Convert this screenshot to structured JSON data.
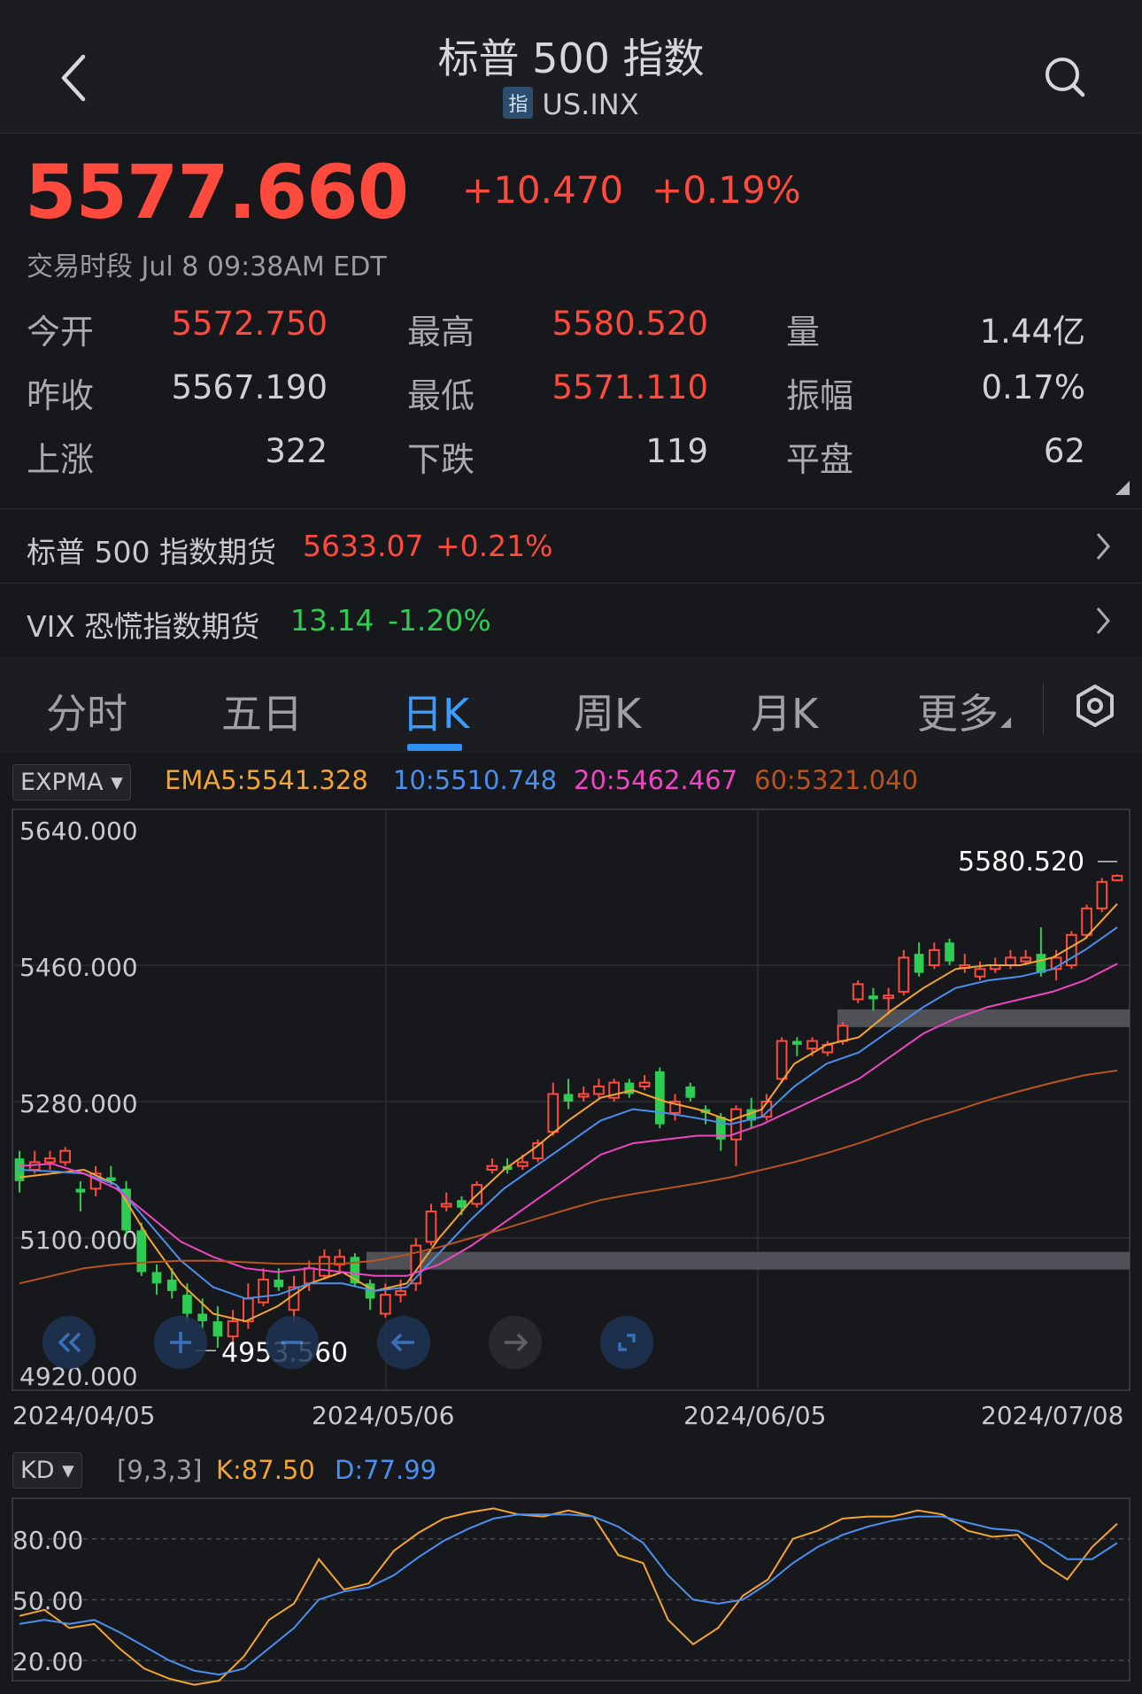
{
  "header": {
    "title": "标普 500 指数",
    "badge": "指",
    "code": "US.INX",
    "back_icon": "chevron-left-icon",
    "search_icon": "search-icon"
  },
  "quote": {
    "price": "5577.660",
    "change": "+10.470",
    "change_pct": "+0.19%",
    "session": "交易时段 Jul 8 09:38AM EDT"
  },
  "stats": [
    [
      {
        "label": "今开",
        "value": "5572.750",
        "color": "red"
      },
      {
        "label": "最高",
        "value": "5580.520",
        "color": "red"
      },
      {
        "label": "量",
        "value": "1.44亿",
        "color": "gray"
      }
    ],
    [
      {
        "label": "昨收",
        "value": "5567.190",
        "color": "gray"
      },
      {
        "label": "最低",
        "value": "5571.110",
        "color": "red"
      },
      {
        "label": "振幅",
        "value": "0.17%",
        "color": "gray"
      }
    ],
    [
      {
        "label": "上涨",
        "value": "322",
        "color": "gray"
      },
      {
        "label": "下跌",
        "value": "119",
        "color": "gray"
      },
      {
        "label": "平盘",
        "value": "62",
        "color": "gray"
      }
    ]
  ],
  "futures": [
    {
      "label": "标普 500 指数期货",
      "value": "5633.07",
      "pct": "+0.21%",
      "color": "red"
    },
    {
      "label": "VIX 恐慌指数期货",
      "value": "13.14",
      "pct": "-1.20%",
      "color": "green"
    }
  ],
  "tabs": [
    "分时",
    "五日",
    "日K",
    "周K",
    "月K",
    "更多"
  ],
  "active_tab": "日K",
  "indicator": {
    "name": "EXPMA",
    "ema5": "EMA5:5541.328",
    "ema10": "10:5510.748",
    "ema20": "20:5462.467",
    "ema60": "60:5321.040"
  },
  "kd": {
    "name": "KD",
    "params": "[9,3,3]",
    "k": "K:87.50",
    "d": "D:77.99"
  },
  "colors": {
    "up": "#ff4a3d",
    "down": "#2ecc52",
    "ema5": "#f4a531",
    "ema10": "#4b8ff0",
    "ema20": "#ee46c4",
    "ema60": "#b9541f",
    "accent": "#3a9dff"
  },
  "chart_data": [
    {
      "type": "candlestick",
      "y_ticks": [
        "5640.000",
        "5460.000",
        "5280.000",
        "5100.000",
        "4920.000"
      ],
      "ylim": [
        4920,
        5640
      ],
      "x_ticks": [
        "2024/04/05",
        "2024/05/06",
        "2024/06/05",
        "2024/07/08"
      ],
      "high_label": "5580.520",
      "low_label": "4953.560",
      "candles": [
        [
          5205,
          5175,
          5215,
          5160
        ],
        [
          5190,
          5200,
          5215,
          5185
        ],
        [
          5200,
          5205,
          5215,
          5190
        ],
        [
          5200,
          5215,
          5220,
          5195
        ],
        [
          5165,
          5160,
          5175,
          5135
        ],
        [
          5165,
          5185,
          5195,
          5155
        ],
        [
          5180,
          5175,
          5195,
          5170
        ],
        [
          5165,
          5110,
          5175,
          5105
        ],
        [
          5110,
          5055,
          5120,
          5050
        ],
        [
          5055,
          5040,
          5065,
          5025
        ],
        [
          5045,
          5030,
          5060,
          5020
        ],
        [
          5025,
          5000,
          5040,
          4990
        ],
        [
          5000,
          4990,
          5020,
          4980
        ],
        [
          4990,
          4970,
          5010,
          4955
        ],
        [
          4970,
          4990,
          5005,
          4960
        ],
        [
          4990,
          5020,
          5040,
          4980
        ],
        [
          5015,
          5045,
          5060,
          5010
        ],
        [
          5045,
          5035,
          5060,
          5030
        ],
        [
          5005,
          5035,
          5050,
          4990
        ],
        [
          5040,
          5060,
          5070,
          5030
        ],
        [
          5050,
          5075,
          5085,
          5045
        ],
        [
          5065,
          5075,
          5085,
          5055
        ],
        [
          5075,
          5040,
          5080,
          5035
        ],
        [
          5040,
          5020,
          5045,
          5005
        ],
        [
          5000,
          5025,
          5040,
          4995
        ],
        [
          5025,
          5030,
          5045,
          5015
        ],
        [
          5040,
          5090,
          5100,
          5030
        ],
        [
          5095,
          5135,
          5145,
          5090
        ],
        [
          5145,
          5145,
          5160,
          5135
        ],
        [
          5150,
          5140,
          5155,
          5130
        ],
        [
          5145,
          5170,
          5175,
          5140
        ],
        [
          5190,
          5195,
          5205,
          5185
        ],
        [
          5195,
          5190,
          5205,
          5185
        ],
        [
          5195,
          5200,
          5210,
          5190
        ],
        [
          5205,
          5225,
          5230,
          5200
        ],
        [
          5240,
          5290,
          5305,
          5235
        ],
        [
          5290,
          5280,
          5310,
          5270
        ],
        [
          5290,
          5290,
          5300,
          5280
        ],
        [
          5290,
          5300,
          5310,
          5285
        ],
        [
          5285,
          5305,
          5310,
          5280
        ],
        [
          5305,
          5290,
          5310,
          5285
        ],
        [
          5300,
          5305,
          5315,
          5295
        ],
        [
          5320,
          5250,
          5325,
          5245
        ],
        [
          5265,
          5280,
          5290,
          5255
        ],
        [
          5300,
          5285,
          5305,
          5280
        ],
        [
          5270,
          5265,
          5275,
          5250
        ],
        [
          5260,
          5230,
          5265,
          5215
        ],
        [
          5230,
          5270,
          5275,
          5195
        ],
        [
          5270,
          5255,
          5285,
          5245
        ],
        [
          5260,
          5280,
          5290,
          5255
        ],
        [
          5310,
          5360,
          5365,
          5305
        ],
        [
          5360,
          5355,
          5365,
          5340
        ],
        [
          5350,
          5360,
          5365,
          5340
        ],
        [
          5345,
          5355,
          5360,
          5340
        ],
        [
          5360,
          5380,
          5385,
          5355
        ],
        [
          5415,
          5435,
          5440,
          5410
        ],
        [
          5420,
          5415,
          5430,
          5400
        ],
        [
          5420,
          5420,
          5430,
          5395
        ],
        [
          5425,
          5470,
          5480,
          5420
        ],
        [
          5475,
          5450,
          5490,
          5445
        ],
        [
          5460,
          5480,
          5490,
          5455
        ],
        [
          5490,
          5465,
          5495,
          5460
        ],
        [
          5460,
          5460,
          5475,
          5450
        ],
        [
          5445,
          5455,
          5465,
          5440
        ],
        [
          5455,
          5460,
          5470,
          5450
        ],
        [
          5460,
          5470,
          5480,
          5455
        ],
        [
          5465,
          5470,
          5480,
          5460
        ],
        [
          5475,
          5450,
          5510,
          5445
        ],
        [
          5455,
          5470,
          5480,
          5440
        ],
        [
          5460,
          5500,
          5505,
          5455
        ],
        [
          5500,
          5535,
          5540,
          5495
        ],
        [
          5535,
          5570,
          5575,
          5530
        ],
        [
          5572,
          5578,
          5580,
          5571
        ]
      ],
      "ema_lines": {
        "ema5": [
          5180,
          5185,
          5190,
          5170,
          5100,
          5040,
          5000,
          4990,
          5010,
          5040,
          5055,
          5030,
          5040,
          5100,
          5150,
          5190,
          5220,
          5255,
          5285,
          5295,
          5280,
          5270,
          5255,
          5270,
          5330,
          5355,
          5365,
          5400,
          5430,
          5455,
          5460,
          5460,
          5470,
          5495,
          5541
        ],
        "ema10": [
          5190,
          5188,
          5185,
          5170,
          5120,
          5070,
          5035,
          5020,
          5025,
          5040,
          5040,
          5030,
          5035,
          5080,
          5125,
          5165,
          5195,
          5225,
          5255,
          5270,
          5265,
          5258,
          5250,
          5260,
          5300,
          5330,
          5345,
          5375,
          5405,
          5430,
          5440,
          5445,
          5455,
          5480,
          5510
        ],
        "ema20": [
          5195,
          5198,
          5185,
          5165,
          5130,
          5095,
          5075,
          5060,
          5055,
          5060,
          5055,
          5050,
          5050,
          5065,
          5090,
          5120,
          5150,
          5180,
          5210,
          5225,
          5230,
          5235,
          5235,
          5250,
          5270,
          5290,
          5310,
          5340,
          5370,
          5390,
          5405,
          5415,
          5425,
          5440,
          5462
        ],
        "ema60": [
          5040,
          5050,
          5060,
          5065,
          5068,
          5070,
          5070,
          5068,
          5066,
          5066,
          5066,
          5070,
          5078,
          5088,
          5100,
          5112,
          5125,
          5138,
          5150,
          5158,
          5165,
          5172,
          5180,
          5190,
          5200,
          5212,
          5225,
          5240,
          5255,
          5268,
          5282,
          5294,
          5305,
          5315,
          5321
        ]
      },
      "support_bands": [
        5390,
        5070
      ]
    },
    {
      "type": "line",
      "y_ticks": [
        "80.00",
        "50.00",
        "20.00"
      ],
      "ylim": [
        10,
        100
      ],
      "series": [
        {
          "name": "K",
          "values": [
            42,
            45,
            36,
            38,
            26,
            16,
            11,
            8,
            10,
            22,
            40,
            48,
            70,
            55,
            58,
            74,
            83,
            90,
            93,
            95,
            92,
            91,
            94,
            91,
            72,
            68,
            40,
            28,
            36,
            52,
            60,
            80,
            84,
            90,
            91,
            91,
            94,
            92,
            84,
            81,
            82,
            68,
            60,
            76,
            87.5
          ]
        },
        {
          "name": "D",
          "values": [
            38,
            40,
            38,
            40,
            34,
            27,
            20,
            15,
            13,
            16,
            26,
            36,
            50,
            54,
            56,
            62,
            71,
            79,
            85,
            90,
            92,
            92,
            92,
            91,
            86,
            78,
            62,
            50,
            48,
            50,
            58,
            68,
            76,
            82,
            86,
            89,
            91,
            91,
            88,
            85,
            84,
            78,
            70,
            70,
            78
          ]
        }
      ]
    }
  ]
}
